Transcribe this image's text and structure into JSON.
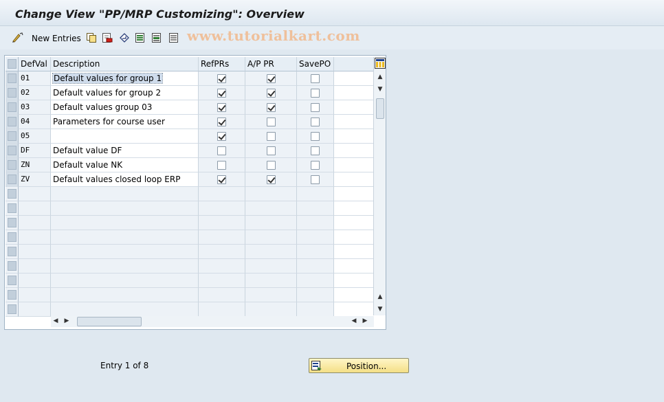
{
  "title": "Change View \"PP/MRP Customizing\": Overview",
  "toolbar": {
    "new_entries": "New Entries",
    "icons": [
      "edit-glasses-icon",
      "copy-icon",
      "delete-icon",
      "undo-icon",
      "select-all-icon",
      "select-block-icon",
      "deselect-icon"
    ]
  },
  "watermark": "www.tutorialkart.com",
  "table": {
    "headers": {
      "defval": "DefVal",
      "description": "Description",
      "refprs": "RefPRs",
      "ap_pr": "A/P PR",
      "savepo": "SavePO"
    },
    "rows": [
      {
        "defval": "01",
        "description": "Default values for group 1",
        "refprs": true,
        "ap_pr": true,
        "savepo": false
      },
      {
        "defval": "02",
        "description": "Default values for group 2",
        "refprs": true,
        "ap_pr": true,
        "savepo": false
      },
      {
        "defval": "03",
        "description": "Default values group 03",
        "refprs": true,
        "ap_pr": true,
        "savepo": false
      },
      {
        "defval": "04",
        "description": "Parameters for course user",
        "refprs": true,
        "ap_pr": false,
        "savepo": false
      },
      {
        "defval": "05",
        "description": "",
        "refprs": true,
        "ap_pr": false,
        "savepo": false
      },
      {
        "defval": "DF",
        "description": "Default value DF",
        "refprs": false,
        "ap_pr": false,
        "savepo": false
      },
      {
        "defval": "ZN",
        "description": "Default value NK",
        "refprs": false,
        "ap_pr": false,
        "savepo": false
      },
      {
        "defval": "ZV",
        "description": "Default values closed loop ERP",
        "refprs": true,
        "ap_pr": true,
        "savepo": false
      }
    ]
  },
  "footer": {
    "entry_text": "Entry 1 of 8",
    "position_button": "Position..."
  }
}
